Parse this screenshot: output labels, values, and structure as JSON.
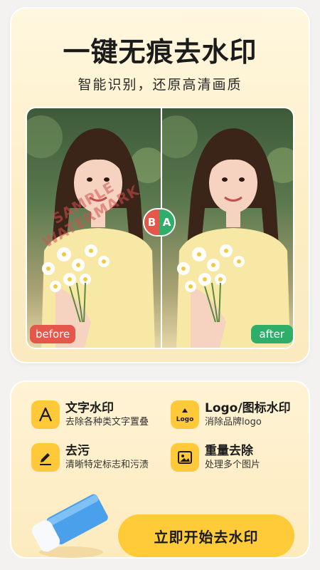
{
  "header": {
    "title": "一键无痕去水印",
    "subtitle": "智能识别，还原高清画质"
  },
  "comparison": {
    "before_label": "before",
    "after_label": "after",
    "toggle_b": "B",
    "toggle_a": "A",
    "watermark_line1": "SAMPLE",
    "watermark_line2": "WATERMARK"
  },
  "features": [
    {
      "name": "文字水印",
      "desc": "去除各种类文字置叠",
      "icon": "letter-a-icon"
    },
    {
      "name": "Logo/图标水印",
      "desc": "消除品牌logo",
      "icon": "logo-icon",
      "icon_text": "Logo"
    },
    {
      "name": "去污",
      "desc": "清晰特定标志和污渍",
      "icon": "pencil-icon"
    },
    {
      "name": "重量去除",
      "desc": "处理多个图片",
      "icon": "image-icon"
    }
  ],
  "cta": {
    "label": "立即开始去水印"
  },
  "colors": {
    "accent": "#ffcb38",
    "before": "#e5574a",
    "after": "#2fae6a"
  }
}
